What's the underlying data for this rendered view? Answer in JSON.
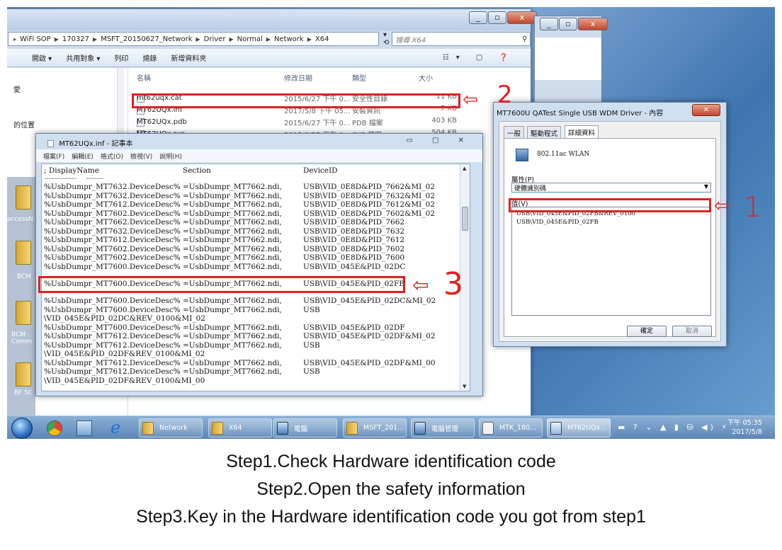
{
  "explorer": {
    "window_controls": {
      "minimize": "_",
      "maximize": "▫",
      "close": "x"
    },
    "breadcrumbs": [
      "WiFi SOP",
      "170327",
      "MSFT_20150627_Network",
      "Driver",
      "Normal",
      "Network",
      "X64"
    ],
    "search_placeholder": "搜尋 X64",
    "toolbar": {
      "open": "開啟",
      "share": "共用對象",
      "print": "列印",
      "burn": "燒錄",
      "new_folder": "新增資料夾"
    },
    "nav_partial": [
      "愛",
      "的位置"
    ],
    "desktop_labels": [
      "accessN",
      "BCM",
      "BCM Comm",
      "BF SC"
    ],
    "columns": {
      "name": "名稱",
      "modified": "修改日期",
      "type": "類型",
      "size": "大小"
    },
    "files": [
      {
        "name": "mt62uqx.cat",
        "modified": "2015/6/27 下午 0...",
        "type": "安全性目錄",
        "size": "11 KB"
      },
      {
        "name": "MT62UQx.inf",
        "modified": "2017/5/8 下午 05...",
        "type": "安裝資訊",
        "size": "7 KB"
      },
      {
        "name": "MT62UQx.pdb",
        "modified": "2015/6/27 下午 0...",
        "type": "PDB 檔案",
        "size": "403 KB"
      },
      {
        "name": "MT62UQx.sys",
        "modified": "2015/6/27 下午 0...",
        "type": "SYS 檔案",
        "size": "504 KB"
      }
    ]
  },
  "notepad": {
    "title": "MT62UQx.inf - 記事本",
    "menu": [
      "檔案(F)",
      "編輯(E)",
      "格式(O)",
      "檢視(V)",
      "說明(H)"
    ],
    "header": {
      "c1": "; DisplayName",
      "c2": "Section",
      "c3": "DeviceID"
    },
    "lines": [
      {
        "c1": "%UsbDumpr_MT7632.DeviceDesc%",
        "c2": "=UsbDumpr_MT7662.ndi,",
        "c3": "USB\\VID_0E8D&PID_7662&MI_02"
      },
      {
        "c1": "%UsbDumpr_MT7632.DeviceDesc%",
        "c2": "=UsbDumpr_MT7662.ndi,",
        "c3": "USB\\VID_0E8D&PID_7632&MI_02"
      },
      {
        "c1": "%UsbDumpr_MT7612.DeviceDesc%",
        "c2": "=UsbDumpr_MT7662.ndi,",
        "c3": "USB\\VID_0E8D&PID_7612&MI_02"
      },
      {
        "c1": "%UsbDumpr_MT7602.DeviceDesc%",
        "c2": "=UsbDumpr_MT7662.ndi,",
        "c3": "USB\\VID_0E8D&PID_7602&MI_02"
      },
      {
        "c1": "%UsbDumpr_MT7662.DeviceDesc%",
        "c2": "=UsbDumpr_MT7662.ndi,",
        "c3": "USB\\VID_0E8D&PID_7662"
      },
      {
        "c1": "%UsbDumpr_MT7632.DeviceDesc%",
        "c2": "=UsbDumpr_MT7662.ndi,",
        "c3": "USB\\VID_0E8D&PID_7632"
      },
      {
        "c1": "%UsbDumpr_MT7612.DeviceDesc%",
        "c2": "=UsbDumpr_MT7662.ndi,",
        "c3": "USB\\VID_0E8D&PID_7612"
      },
      {
        "c1": "%UsbDumpr_MT7602.DeviceDesc%",
        "c2": "=UsbDumpr_MT7662.ndi,",
        "c3": "USB\\VID_0E8D&PID_7602"
      },
      {
        "c1": "%UsbDumpr_MT7602.DeviceDesc%",
        "c2": "=UsbDumpr_MT7662.ndi,",
        "c3": "USB\\VID_0E8D&PID_7600"
      },
      {
        "c1": "%UsbDumpr_MT7600.DeviceDesc%",
        "c2": "=UsbDumpr_MT7662.ndi,",
        "c3": "USB\\VID_045E&PID_02DC"
      }
    ],
    "highlight_line": {
      "c1": "%UsbDumpr_MT7600.DeviceDesc%",
      "c2": "=UsbDumpr_MT7662.ndi,",
      "c3": "USB\\VID_045E&PID_02FB"
    },
    "lines_after": [
      {
        "c1": "%UsbDumpr_MT7600.DeviceDesc%",
        "c2": "=UsbDumpr_MT7662.ndi,",
        "c3": "USB\\VID_045E&PID_02DC&MI_02"
      },
      {
        "c1": "%UsbDumpr_MT7600.DeviceDesc%",
        "c2": "=UsbDumpr_MT7662.ndi,",
        "c3": "USB"
      },
      {
        "c1": "\\VID_045E&PID_02DC&REV_0100&MI_02",
        "c2": "",
        "c3": ""
      },
      {
        "c1": "%UsbDumpr_MT7600.DeviceDesc%",
        "c2": "=UsbDumpr_MT7662.ndi,",
        "c3": "USB\\VID_045E&PID_02DF"
      },
      {
        "c1": "%UsbDumpr_MT7612.DeviceDesc%",
        "c2": "=UsbDumpr_MT7662.ndi,",
        "c3": "USB\\VID_045E&PID_02DF&MI_02"
      },
      {
        "c1": "%UsbDumpr_MT7612.DeviceDesc%",
        "c2": "=UsbDumpr_MT7662.ndi,",
        "c3": "USB"
      },
      {
        "c1": "\\VID_045E&PID_02DF&REV_0100&MI_02",
        "c2": "",
        "c3": ""
      },
      {
        "c1": "%UsbDumpr_MT7612.DeviceDesc%",
        "c2": "=UsbDumpr_MT7662.ndi,",
        "c3": "USB\\VID_045E&PID_02DF&MI_00"
      },
      {
        "c1": "%UsbDumpr_MT7612.DeviceDesc%",
        "c2": "=UsbDumpr_MT7662.ndi,",
        "c3": "USB"
      },
      {
        "c1": "\\VID_045E&PID_02DF&REV_0100&MI_00",
        "c2": "",
        "c3": ""
      }
    ]
  },
  "properties": {
    "title": "MT7600U QATest Single USB WDM Driver - 內容",
    "tabs": [
      "一般",
      "驅動程式",
      "詳細資料"
    ],
    "device_name": "802.11ac WLAN",
    "property_label": "屬性(P)",
    "property_value": "硬體識別碼",
    "value_label": "值(V)",
    "values": [
      "USB\\VID_045E&PID_02FB&REV_0100",
      "USB\\VID_045E&PID_02FB"
    ],
    "ok": "確定",
    "cancel": "取消"
  },
  "taskbar": {
    "buttons": [
      "Network",
      "X64",
      "電腦",
      "MSFT_201...",
      "電腦管理",
      "MTK_180...",
      "MT62UQx..."
    ],
    "time": "下午 05:35",
    "date": "2017/5/8"
  },
  "annotations": {
    "step1": "1",
    "step2": "2",
    "step3": "3",
    "arrow": "⇦"
  },
  "captions": [
    "Step1.Check Hardware identification code",
    "Step2.Open the safety information",
    "Step3.Key in the Hardware identification code you got from step1"
  ],
  "colors": {
    "annotation": "#e02020",
    "taskbar": "#5d86b5",
    "desktop": "#5d8fc4"
  }
}
